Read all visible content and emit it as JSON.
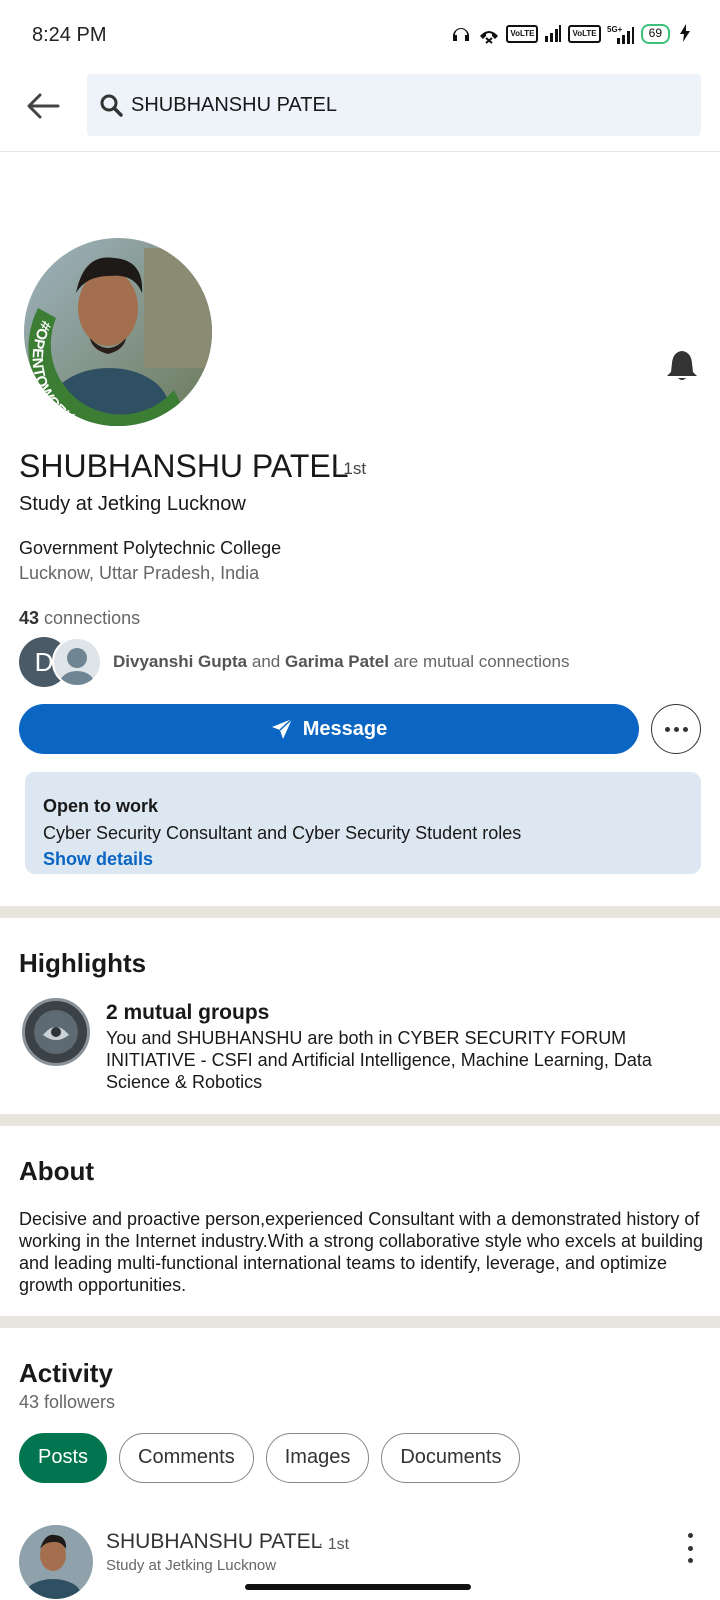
{
  "status_bar": {
    "time": "8:24 PM",
    "battery": "69"
  },
  "search": {
    "query": "SHUBHANSHU PATEL"
  },
  "profile": {
    "name": "SHUBHANSHU PATEL",
    "degree": "· 1st",
    "headline": "Study at Jetking Lucknow",
    "school": "Government Polytechnic College",
    "location": "Lucknow, Uttar Pradesh, India",
    "connections_count": "43",
    "connections_label": "connections",
    "avatar_badge": "#OPENTOWORK",
    "mutual": {
      "avatar_initial": "D",
      "person1": "Divyanshi Gupta",
      "and": "and",
      "person2": "Garima Patel",
      "suffix": "are mutual connections"
    },
    "message_label": "Message"
  },
  "open_to_work": {
    "title": "Open to work",
    "roles": "Cyber Security Consultant and Cyber Security Student roles",
    "link": "Show details"
  },
  "highlights": {
    "title": "Highlights",
    "group_title": "2 mutual groups",
    "group_desc": "You and SHUBHANSHU are both in CYBER SECURITY FORUM INITIATIVE - CSFI and Artificial Intelligence, Machine Learning, Data Science & Robotics"
  },
  "about": {
    "title": "About",
    "text": "Decisive and proactive person,experienced Consultant with a demonstrated history of working in the Internet industry.With a strong collaborative style who excels at building and leading multi-functional international teams to identify, leverage, and optimize growth opportunities."
  },
  "activity": {
    "title": "Activity",
    "followers": "43 followers",
    "tabs": [
      "Posts",
      "Comments",
      "Images",
      "Documents"
    ],
    "post": {
      "name": "SHUBHANSHU PATEL",
      "degree": "· 1st",
      "subtitle": "Study at Jetking Lucknow"
    }
  },
  "colors": {
    "primary": "#0a66c2",
    "active_tab": "#01754f",
    "otw_bg": "#dde7f1"
  }
}
